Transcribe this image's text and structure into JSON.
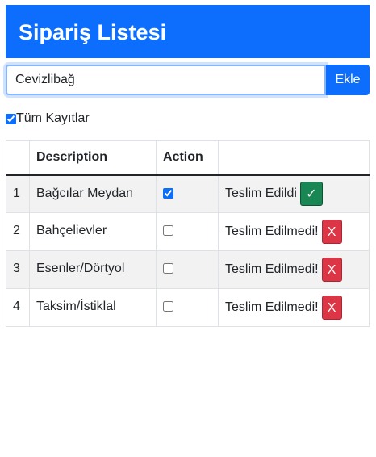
{
  "header": {
    "title": "Sipariş Listesi"
  },
  "form": {
    "input_value": "Cevizlibağ",
    "add_label": "Ekle"
  },
  "filter": {
    "all_label": "Tüm Kayıtlar",
    "checked": true
  },
  "table": {
    "columns": [
      "",
      "Description",
      "Action",
      ""
    ],
    "rows": [
      {
        "num": "1",
        "desc": "Bağcılar Meydan",
        "done": true,
        "status": "Teslim Edildi",
        "icon": "✓"
      },
      {
        "num": "2",
        "desc": "Bahçelievler",
        "done": false,
        "status": "Teslim Edilmedi!",
        "icon": "X"
      },
      {
        "num": "3",
        "desc": "Esenler/Dörtyol",
        "done": false,
        "status": "Teslim Edilmedi!",
        "icon": "X"
      },
      {
        "num": "4",
        "desc": "Taksim/İstiklal",
        "done": false,
        "status": "Teslim Edilmedi!",
        "icon": "X"
      }
    ]
  },
  "colors": {
    "primary": "#0d6efd",
    "success": "#198754",
    "danger": "#dc3545"
  }
}
